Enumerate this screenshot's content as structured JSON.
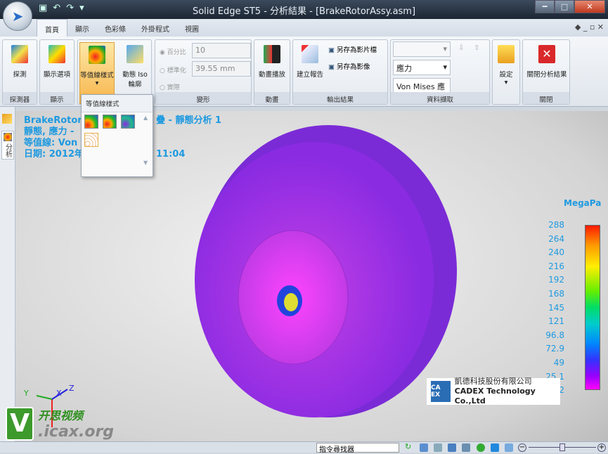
{
  "window": {
    "title": "Solid Edge ST5 - 分析結果 - [BrakeRotorAssy.asm]"
  },
  "tabs": [
    "首頁",
    "顯示",
    "色彩條",
    "外掛程式",
    "視圖"
  ],
  "ribbon": {
    "groups": [
      "探測器",
      "顯示",
      "",
      "變形",
      "動畫",
      "輸出結果",
      "資料擷取",
      "",
      "關閉"
    ],
    "buttons": {
      "probe": "探測",
      "display_options": "顯示選項",
      "contour_style": "等值線樣式",
      "dynamic_iso": "動態 Iso 輪廓",
      "animate": "動畫播放",
      "create_report": "建立報告",
      "save_video": "另存為影片檔",
      "save_image": "另存為影像",
      "settings": "設定",
      "close_results": "關閉分析結果"
    },
    "deform": {
      "percent_label": "百分比",
      "percent_value": "10",
      "normalized_label": "標準化",
      "normalized_value": "39.55 mm",
      "actual_label": "實際"
    },
    "data_select": {
      "result_type": "應力",
      "component": "Von Mises 應"
    }
  },
  "dropdown": {
    "title": "等值線樣式"
  },
  "left_panel": {
    "tab": "分析"
  },
  "info": {
    "line1a": "BrakeRotorA",
    "line1b": "疊 - 靜態分析 1",
    "line2": "靜態, 應力 -",
    "line3": "等值線: Von",
    "line4a": "日期: 2012年",
    "line4b": "11:04"
  },
  "legend": {
    "title": "MegaPa",
    "values": [
      "288",
      "264",
      "240",
      "216",
      "192",
      "168",
      "145",
      "121",
      "96.8",
      "72.9",
      "49",
      "25.1",
      "1.22"
    ]
  },
  "company": {
    "logo": "CADEX",
    "name_zh": "凱德科技股份有限公司",
    "name_en": "CADEX Technology Co.,Ltd"
  },
  "statusbar": {
    "command_finder": "指令尋找器"
  },
  "watermark": {
    "letter": "V",
    "zh": "开思视频",
    "site": ".icax.org"
  },
  "axes": {
    "x": "X",
    "y": "Y",
    "z": "Z"
  }
}
